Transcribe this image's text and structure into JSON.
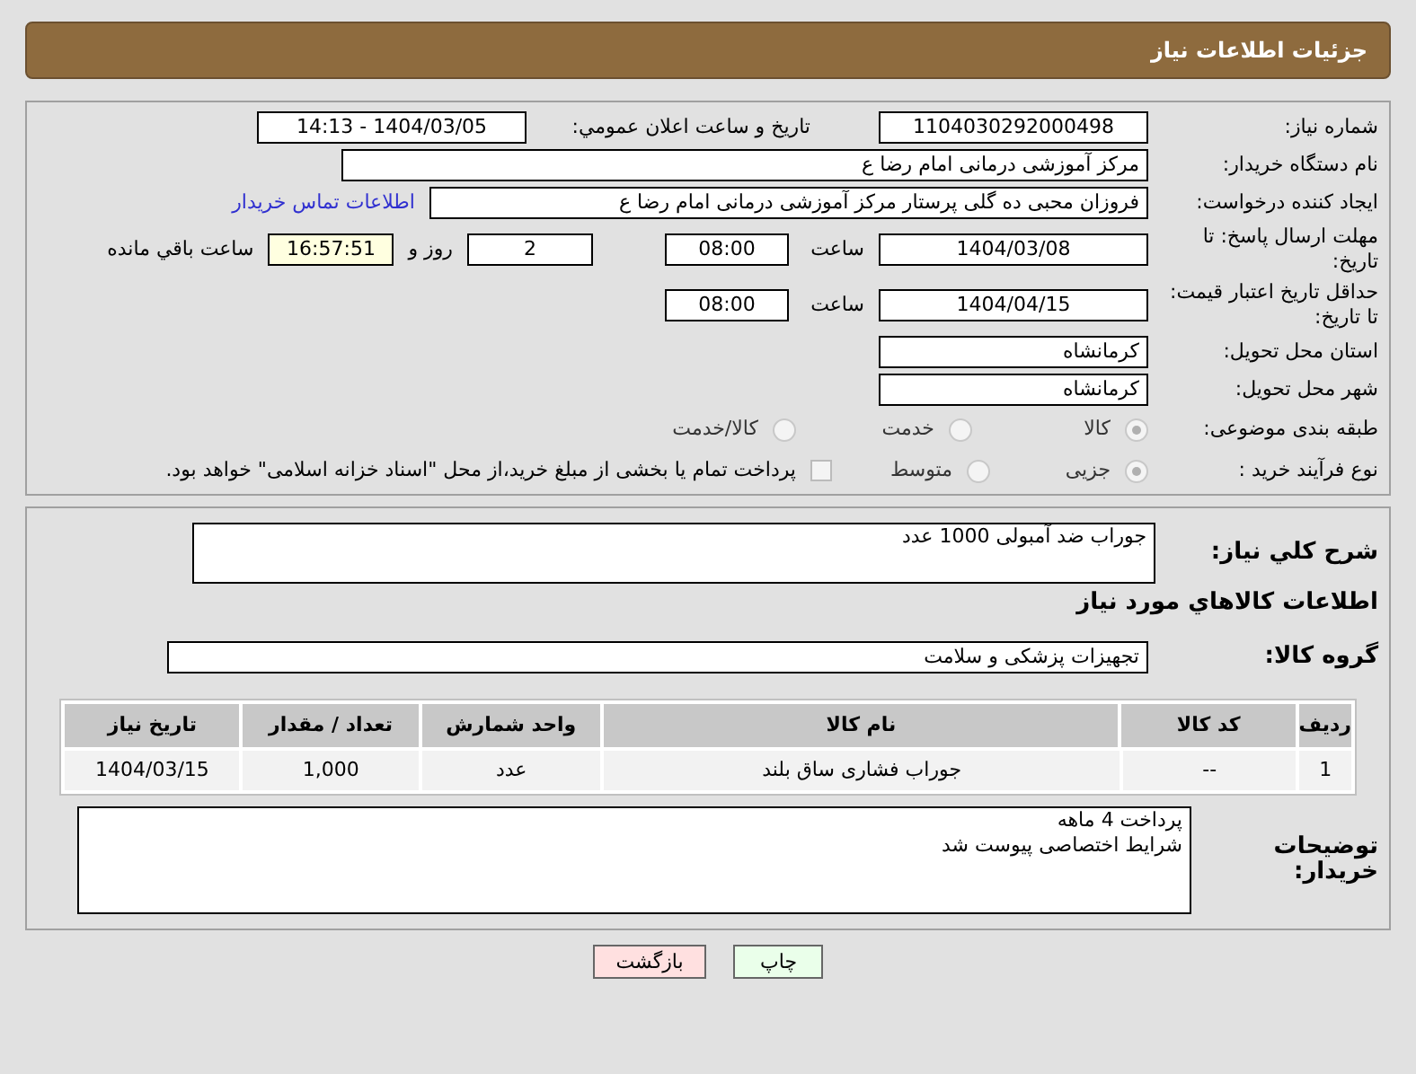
{
  "header": {
    "title": "جزئیات اطلاعات نیاز"
  },
  "need_number": {
    "label": "شماره نیاز:",
    "value": "1104030292000498"
  },
  "announce": {
    "label": "تاریخ و ساعت اعلان عمومي:",
    "value": "1404/03/05 - 14:13"
  },
  "buyer_org": {
    "label": "نام دستگاه خریدار:",
    "value": "مرکز آموزشی  درمانی امام رضا  ع"
  },
  "requester": {
    "label": "ایجاد کننده درخواست:",
    "value": "فروزان محبی ده گلی پرستار مرکز آموزشی  درمانی امام رضا  ع",
    "link": "اطلاعات تماس خریدار"
  },
  "deadline": {
    "label": "مهلت ارسال پاسخ: تا تاریخ:",
    "date": "1404/03/08",
    "time_label": "ساعت",
    "time": "08:00",
    "days": "2",
    "days_label": "روز و",
    "remaining": "16:57:51",
    "remaining_label": "ساعت باقي مانده"
  },
  "validity": {
    "label": "حداقل تاریخ اعتبار قیمت: تا تاریخ:",
    "date": "1404/04/15",
    "time_label": "ساعت",
    "time": "08:00"
  },
  "province": {
    "label": "استان محل تحویل:",
    "value": "کرمانشاه"
  },
  "city": {
    "label": "شهر محل تحویل:",
    "value": "کرمانشاه"
  },
  "category": {
    "label": "طبقه بندی موضوعی:",
    "options": [
      {
        "label": "کالا",
        "selected": true
      },
      {
        "label": "خدمت",
        "selected": false
      },
      {
        "label": "کالا/خدمت",
        "selected": false
      }
    ]
  },
  "process": {
    "label": "نوع فرآیند خرید :",
    "options": [
      {
        "label": "جزیی",
        "selected": true
      },
      {
        "label": "متوسط",
        "selected": false
      }
    ],
    "treasury": {
      "checked": false,
      "label": "پرداخت تمام یا بخشی از مبلغ خرید،از محل \"اسناد خزانه اسلامی\" خواهد بود."
    }
  },
  "summary": {
    "label": "شرح کلي نیاز:",
    "value": "جوراب ضد آمبولی    1000 عدد"
  },
  "goods_heading": "اطلاعات کالاهاي مورد نیاز",
  "goods_group": {
    "label": "گروه کالا:",
    "value": "تجهیزات پزشکی و سلامت"
  },
  "table": {
    "columns": [
      "ردیف",
      "کد کالا",
      "نام کالا",
      "واحد شمارش",
      "تعداد / مقدار",
      "تاریخ نیاز"
    ],
    "rows": [
      [
        "1",
        "--",
        "جوراب فشاری ساق بلند",
        "عدد",
        "1,000",
        "1404/03/15"
      ]
    ]
  },
  "notes": {
    "label": "توضیحات خریدار:",
    "lines": [
      "پرداخت 4 ماهه",
      "شرایط اختصاصی پیوست شد"
    ]
  },
  "buttons": [
    {
      "label": "چاپ",
      "kind": "print"
    },
    {
      "label": "بازگشت",
      "kind": "back"
    }
  ]
}
